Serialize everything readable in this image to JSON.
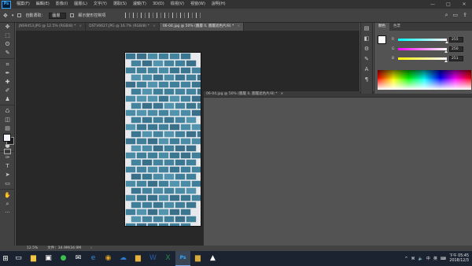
{
  "app": {
    "logo": "Ps"
  },
  "menubar": {
    "items": [
      "檔案(F)",
      "編輯(E)",
      "影像(I)",
      "圖層(L)",
      "文字(Y)",
      "選取(S)",
      "濾鏡(T)",
      "3D(D)",
      "檢視(V)",
      "視窗(W)",
      "說明(H)"
    ],
    "window_controls": {
      "minimize": "—",
      "maximize": "□",
      "close": "✕"
    }
  },
  "options_bar": {
    "auto_select_label": "自動選取：",
    "auto_select_value": "圖層",
    "transform_label": "顯示變形控制項"
  },
  "tabs": [
    {
      "label": "JNS9453.JPG @ 12.5% (RGB/8) *",
      "close": "×"
    },
    {
      "label": "DSTV6627.JPG @ 16.7% (RGB/8) *",
      "close": "×"
    },
    {
      "label": "06-04.jpg @ 50% (圖層 0, 圖層遮色片/8) *",
      "close": "×"
    }
  ],
  "floating_window": {
    "title": "06-04.jpg @ 50% (圖層 0, 圖層遮色片/8) *",
    "close": "×"
  },
  "status": {
    "zoom": "12.5%",
    "doc_size": "文件：34.9M/34.9M",
    "arrow": "›"
  },
  "color_panel": {
    "tabs": [
      "顏色",
      "色票"
    ],
    "channels": [
      {
        "label": "R",
        "value": "255",
        "fraction": 1.0
      },
      {
        "label": "G",
        "value": "250",
        "fraction": 0.98
      },
      {
        "label": "B",
        "value": "251",
        "fraction": 0.984
      }
    ],
    "foreground_color": "#ffffff",
    "background_color": "#1c1c1c"
  },
  "tools": [
    "move-icon",
    "marquee-icon",
    "lasso-icon",
    "quick-select-icon",
    "crop-icon",
    "eyedropper-icon",
    "healing-icon",
    "brush-icon",
    "stamp-icon",
    "history-brush-icon",
    "eraser-icon",
    "gradient-icon",
    "blur-icon",
    "dodge-icon",
    "pen-icon",
    "type-icon",
    "path-select-icon",
    "shape-icon",
    "hand-icon",
    "zoom-icon",
    "more-icon"
  ],
  "tool_glyphs": [
    "✥",
    "⬚",
    "ʘ",
    "✎",
    "⌗",
    "✒",
    "✚",
    "✐",
    "♟",
    "♺",
    "◫",
    "▤",
    "◆",
    "●",
    "✑",
    "T",
    "➤",
    "▭",
    "✋",
    "⌕",
    "···"
  ],
  "taskbar": {
    "start": "⊞",
    "icons": [
      {
        "name": "taskview-icon",
        "glyph": "▭",
        "color": "#ffffff"
      },
      {
        "name": "file-explorer-icon",
        "glyph": "▆",
        "color": "#f4c542"
      },
      {
        "name": "store-icon",
        "glyph": "▣",
        "color": "#ffffff"
      },
      {
        "name": "line-icon",
        "glyph": "●",
        "color": "#3ac34c"
      },
      {
        "name": "mail-icon",
        "glyph": "✉",
        "color": "#ffffff"
      },
      {
        "name": "edge-icon",
        "glyph": "e",
        "color": "#3b8cd9"
      },
      {
        "name": "chrome-icon",
        "glyph": "◉",
        "color": "#e2a322"
      },
      {
        "name": "onedrive-icon",
        "glyph": "☁",
        "color": "#2e78d0"
      },
      {
        "name": "folder-icon",
        "glyph": "▆",
        "color": "#e6b23c"
      },
      {
        "name": "word-icon",
        "glyph": "W",
        "color": "#2b5fab"
      },
      {
        "name": "excel-icon",
        "glyph": "X",
        "color": "#1f8a4c"
      },
      {
        "name": "photoshop-icon",
        "glyph": "Ps",
        "color": "#31a8ff"
      },
      {
        "name": "explorer2-icon",
        "glyph": "▆",
        "color": "#d6a93a"
      },
      {
        "name": "photos-icon",
        "glyph": "▲",
        "color": "#ffffff"
      }
    ],
    "tray": {
      "up": "^",
      "network": "⌘",
      "volume": "🔈",
      "lang_zh": "中",
      "lang_en": "英",
      "ime": "⌨"
    },
    "time": "下午 05:45",
    "date": "2018/12/3"
  }
}
